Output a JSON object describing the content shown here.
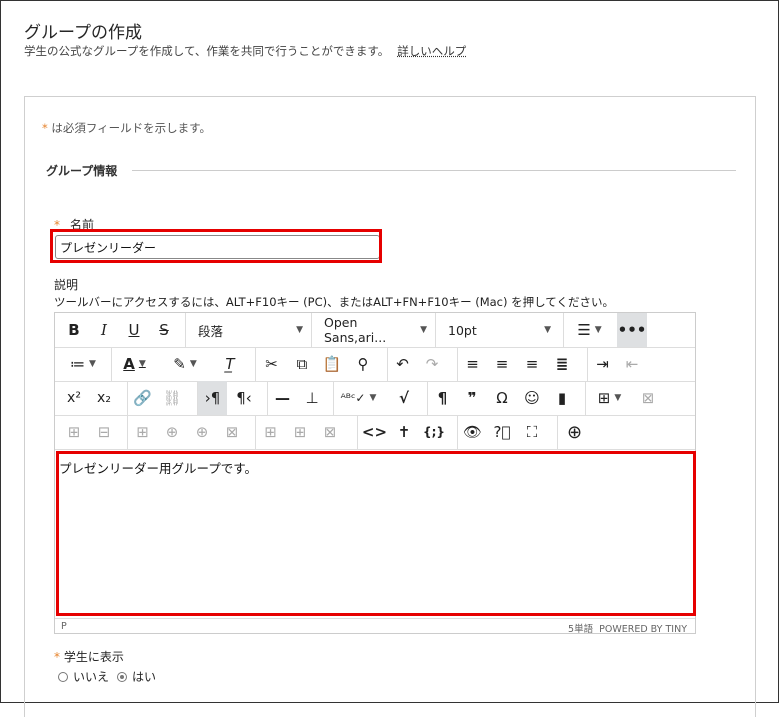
{
  "page": {
    "title": "グループの作成",
    "subtitle": "学生の公式なグループを作成して、作業を共同で行うことができます。",
    "help_link": "詳しいヘルプ"
  },
  "form": {
    "required_star": "*",
    "required_note": "は必須フィールドを示します。",
    "section_title": "グループ情報",
    "name_label": "名前",
    "name_value": "プレゼンリーダー",
    "description_label": "説明",
    "description_help": "ツールバーにアクセスするには、ALT+F10キー (PC)、またはALT+FN+F10キー (Mac) を押してください。",
    "show_students_label": "学生に表示",
    "radio_no": "いいえ",
    "radio_yes": "はい",
    "radio_selected": "はい"
  },
  "editor": {
    "block_format": "段落",
    "font_family": "Open Sans,ari...",
    "font_size": "10pt",
    "content": "プレゼンリーダー用グループです。",
    "status_path": "P",
    "word_count": "5単語",
    "powered_by": "POWERED BY TINY"
  },
  "colors": {
    "highlight": "#e60000",
    "required": "#e6832c"
  }
}
